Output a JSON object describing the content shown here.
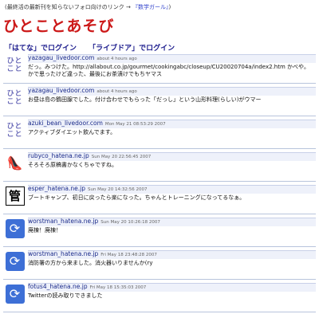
{
  "top_note": {
    "text": "(最終活の最新刊を知らないフォロ向けのリンク → ",
    "link": "『数学ガール』",
    "suffix": ")"
  },
  "site_title": "ひとことあそび",
  "login": {
    "hatena": "「はてな」でログイン",
    "livedoor": "「ライブドア」でログイン"
  },
  "entries": [
    {
      "user": "yazagau_livedoor.com",
      "time": "about 4 hours ago",
      "body": "だっ。みつけた。http://allabout.co.jp/gourmet/cookingabc/closeup/CU20020704a/index2.htm かべや。かで思ったけど違った、最後にお茶漬けでもちヤマス",
      "avatar": "hitokoto-icon"
    },
    {
      "user": "yazagau_livedoor.com",
      "time": "about 4 hours ago",
      "body": "お昼は島の鶴田腺でした。付け合わせでもらった「だっし」という山形料理(らしい)がウマー",
      "avatar": "hitokoto-icon"
    },
    {
      "user": "azuki_bean_livedoor.com",
      "time": "Mon May 21 08:53:29 2007",
      "body": "アクティブダイエット飲んでます。",
      "avatar": "hitokoto-icon"
    },
    {
      "user": "rubyco_hatena.ne.jp",
      "time": "Sun May 20 22:56:45 2007",
      "body": "そろそろ原稿書かなくちゃですね。",
      "avatar": "shoe-icon"
    },
    {
      "user": "esper_hatena.ne.jp",
      "time": "Sun May 20 14:32:56 2007",
      "body": "ブートキャンプ、初日に戻ったら楽になった。ちゃんとトレーニングになってるなぁ。",
      "avatar": "kanji-icon"
    },
    {
      "user": "worstman_hatena.ne.jp",
      "time": "Sun May 20 10:26:18 2007",
      "body": "廃棟！廃棟！",
      "avatar": "refresh-icon"
    },
    {
      "user": "worstman_hatena.ne.jp",
      "time": "Fri May 18 23:48:28 2007",
      "body": "消防署の方から来ました。消火器いりませんか(ry",
      "avatar": "refresh-icon"
    },
    {
      "user": "fotus4_hatena.ne.jp",
      "time": "Fri May 18 15:35:03 2007",
      "body": "Twitterの読み取りできました",
      "avatar": "refresh-icon"
    }
  ],
  "avatar_glyphs": {
    "hitokoto": "ひと\nこと",
    "shoe": "👠",
    "kanji": "管",
    "refresh": "⟳"
  },
  "colors": {
    "title": "#cc1818",
    "login": "#1a1a8c",
    "user": "#1a2a8a",
    "header_bg": "#eef1fa",
    "refresh_bg": "#3d6fd6"
  }
}
